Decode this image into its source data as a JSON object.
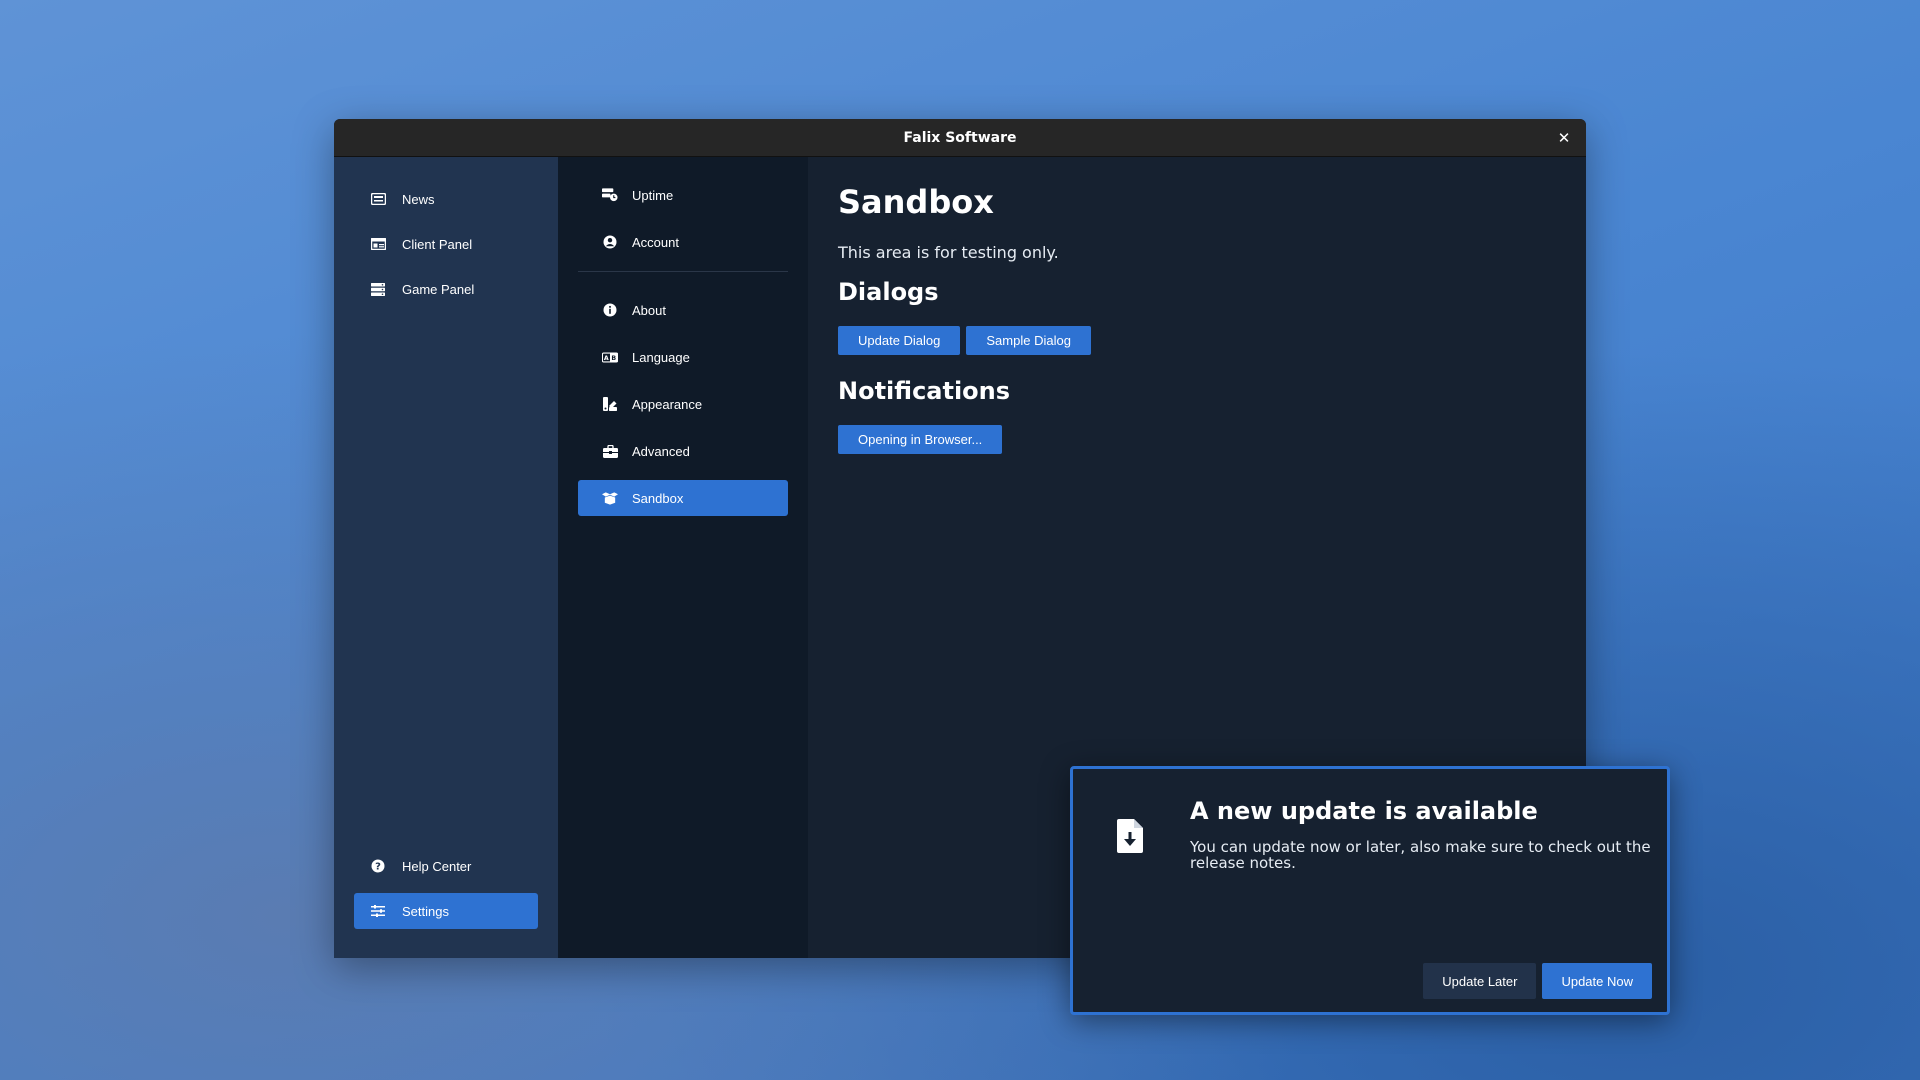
{
  "window": {
    "title": "Falix Software"
  },
  "sidebar": {
    "items": [
      {
        "label": "News",
        "icon": "news-icon"
      },
      {
        "label": "Client Panel",
        "icon": "client-panel-icon"
      },
      {
        "label": "Game Panel",
        "icon": "game-panel-icon"
      }
    ],
    "bottom_items": [
      {
        "label": "Help Center",
        "icon": "help-icon"
      },
      {
        "label": "Settings",
        "icon": "settings-sliders-icon",
        "active": true
      }
    ]
  },
  "subnav": {
    "top_items": [
      {
        "label": "Uptime",
        "icon": "uptime-icon"
      },
      {
        "label": "Account",
        "icon": "account-icon"
      }
    ],
    "items": [
      {
        "label": "About",
        "icon": "info-icon"
      },
      {
        "label": "Language",
        "icon": "language-icon"
      },
      {
        "label": "Appearance",
        "icon": "appearance-icon"
      },
      {
        "label": "Advanced",
        "icon": "advanced-icon"
      },
      {
        "label": "Sandbox",
        "icon": "sandbox-icon",
        "active": true
      }
    ]
  },
  "content": {
    "title": "Sandbox",
    "description": "This area is for testing only.",
    "dialogs_heading": "Dialogs",
    "dialog_buttons": [
      "Update Dialog",
      "Sample Dialog"
    ],
    "notifications_heading": "Notifications",
    "notification_buttons": [
      "Opening in Browser..."
    ]
  },
  "update_dialog": {
    "title": "A new update is available",
    "text": "You can update now or later, also make sure to check out the release notes.",
    "later_label": "Update Later",
    "now_label": "Update Now",
    "icon": "file-download-icon"
  },
  "colors": {
    "accent": "#2e72d2",
    "sidebar": "#213450",
    "subnav": "#0f1a28",
    "content": "#162130"
  }
}
